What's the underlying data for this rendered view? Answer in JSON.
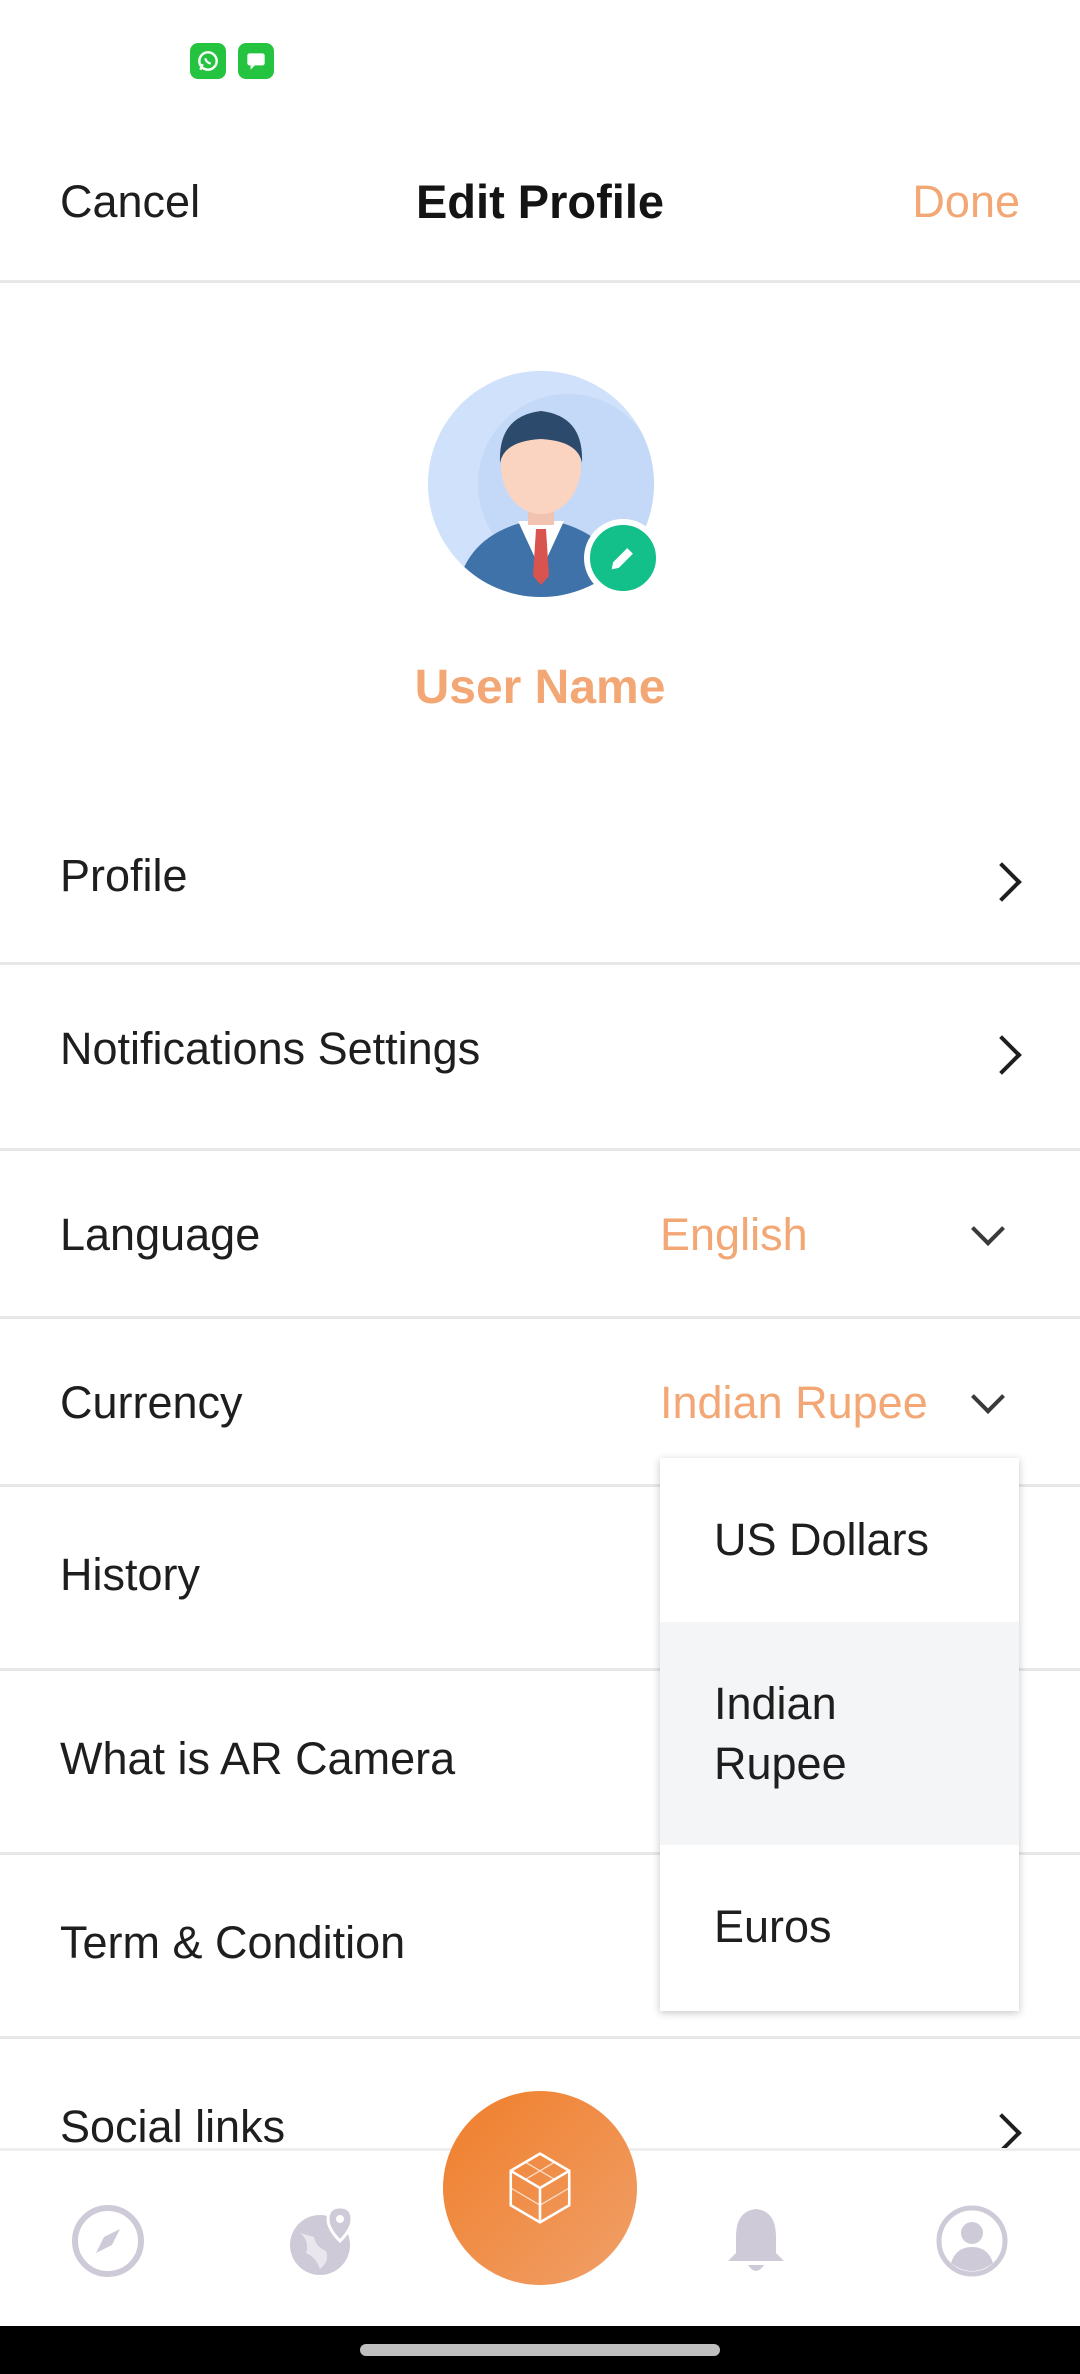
{
  "status_bar": {
    "notifications": [
      "whatsapp-icon",
      "messages-icon"
    ]
  },
  "header": {
    "cancel_label": "Cancel",
    "title": "Edit Profile",
    "done_label": "Done"
  },
  "profile": {
    "avatar_icon": "user-avatar",
    "edit_icon": "pencil-icon",
    "user_name": "User Name"
  },
  "menu": {
    "profile": "Profile",
    "notifications": "Notifications Settings",
    "language": {
      "label": "Language",
      "value": "English"
    },
    "currency": {
      "label": "Currency",
      "value": "Indian Rupee"
    },
    "history": "History",
    "ar_camera": "What is AR Camera",
    "terms": "Term & Condition",
    "social": "Social links"
  },
  "currency_dropdown": {
    "options": [
      "US Dollars",
      "Indian Rupee",
      "Euros"
    ],
    "selected": "Indian Rupee"
  },
  "bottom_nav": {
    "items": [
      "compass-icon",
      "globe-location-icon",
      "ar-cube-icon",
      "bell-icon",
      "profile-icon"
    ]
  },
  "colors": {
    "accent": "#f2a774",
    "fab_gradient_start": "#f07e2a",
    "badge_green": "#13c08a",
    "nav_inactive": "#cfcad8"
  }
}
